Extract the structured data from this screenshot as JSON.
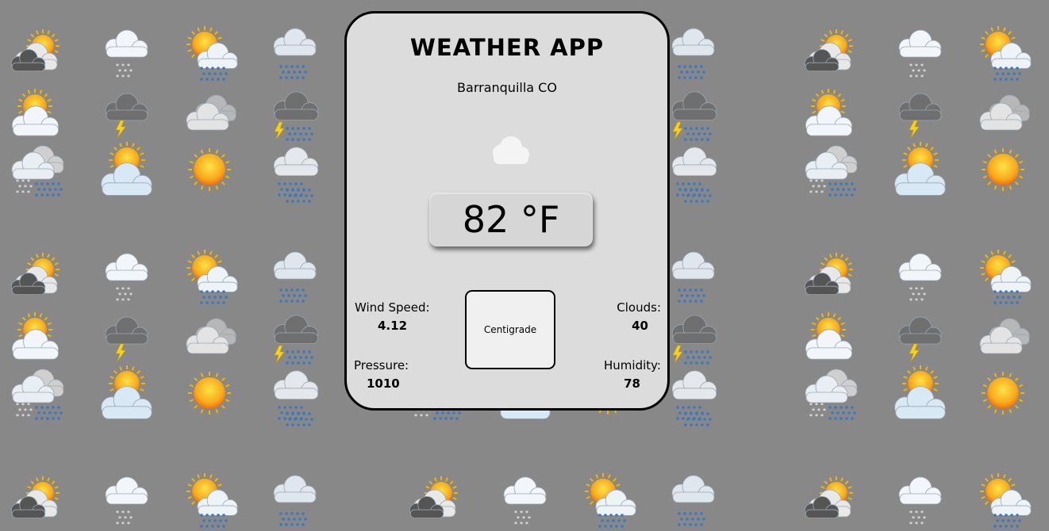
{
  "app": {
    "title": "WEATHER APP",
    "city": "Barranquilla CO"
  },
  "current": {
    "icon": "cloud-icon",
    "temperature_display": "82 °F",
    "temperature": 82,
    "unit": "°F"
  },
  "stats": {
    "wind_speed_label": "Wind Speed:",
    "wind_speed_value": "4.12",
    "clouds_label": "Clouds:",
    "clouds_value": "40",
    "pressure_label": "Pressure:",
    "pressure_value": "1010",
    "humidity_label": "Humidity:",
    "humidity_value": "78"
  },
  "unit_toggle": {
    "label": "Centigrade"
  },
  "background": {
    "color": "#888888",
    "icon_pattern": [
      [
        "partly-cloudy-dark-icon",
        "snow-cloud-icon",
        "sun-rain-icon",
        "rain-cloud-icon"
      ],
      [
        "partly-sunny-icon",
        "thunderstorm-icon",
        "overcast-icon",
        "thunder-rain-icon"
      ],
      [
        "sleet-icon",
        "sun-behind-cloud-icon",
        "sun-icon",
        "heavy-rain-icon"
      ]
    ]
  },
  "colors": {
    "card_background": "#dcdcdc",
    "card_border": "#000000",
    "button_background": "#f0f0f0"
  }
}
